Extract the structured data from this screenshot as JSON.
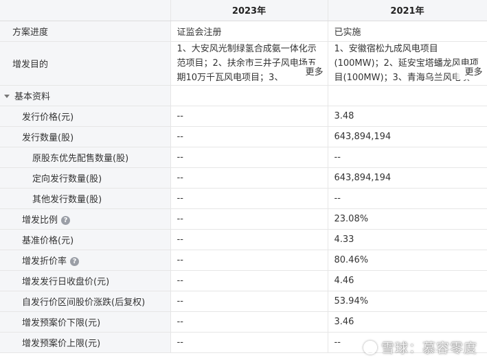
{
  "header": {
    "col_years": [
      "2023年",
      "2021年"
    ]
  },
  "rows": {
    "progress": {
      "label": "方案进度",
      "v2023": "证监会注册",
      "v2021": "已实施"
    },
    "purpose": {
      "label": "增发目的",
      "v2023": "1、大安风光制绿氢合成氨一体化示范项目；2、扶余市三井子风电场五期10万千瓦风电项目；3、",
      "v2021": "1、安徽宿松九成风电项目(100MW)；2、延安宝塔蟠龙风电项目(100MW)；3、青海乌兰风电项",
      "more": "更多"
    },
    "basic_section": {
      "label": "基本资料"
    },
    "issue_price": {
      "label": "发行价格(元)",
      "v2023": "--",
      "v2021": "3.48"
    },
    "issue_qty": {
      "label": "发行数量(股)",
      "v2023": "--",
      "v2021": "643,894,194"
    },
    "orig_holder_qty": {
      "label": "原股东优先配售数量(股)",
      "v2023": "--",
      "v2021": "--"
    },
    "directed_qty": {
      "label": "定向发行数量(股)",
      "v2023": "--",
      "v2021": "643,894,194"
    },
    "other_qty": {
      "label": "其他发行数量(股)",
      "v2023": "--",
      "v2021": "--"
    },
    "ratio": {
      "label": "增发比例",
      "v2023": "--",
      "v2021": "23.08%"
    },
    "base_price": {
      "label": "基准价格(元)",
      "v2023": "--",
      "v2021": "4.33"
    },
    "discount": {
      "label": "增发折价率",
      "v2023": "--",
      "v2021": "80.46%"
    },
    "close_price": {
      "label": "增发发行日收盘价(元)",
      "v2023": "--",
      "v2021": "4.46"
    },
    "change": {
      "label": "自发行价区间股价涨跌(后复权)",
      "v2023": "--",
      "v2021": "53.94%"
    },
    "lower_limit": {
      "label": "增发预案价下限(元)",
      "v2023": "--",
      "v2021": "3.46"
    },
    "upper_limit": {
      "label": "增发预案价上限(元)",
      "v2023": "--",
      "v2021": "--"
    }
  },
  "help_icon_glyph": "?",
  "watermark": "雪球：慕容零度",
  "colors": {
    "positive": "#e23b3b",
    "header_bg": "#f5f6f8",
    "border": "#e6e6e6"
  }
}
